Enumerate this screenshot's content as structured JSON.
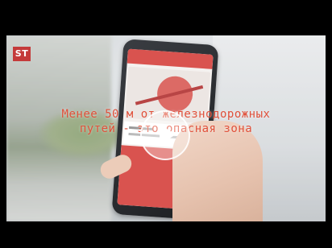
{
  "logo": {
    "text": "ST"
  },
  "caption": {
    "line1": "Менее 50 м от железнодорожных",
    "line2": "путей - это опасная зона"
  },
  "icons": {
    "play": "play-icon"
  },
  "colors": {
    "caption": "#e0503a",
    "logo_bg": "#c43a3a",
    "app_accent": "#d9534f"
  }
}
